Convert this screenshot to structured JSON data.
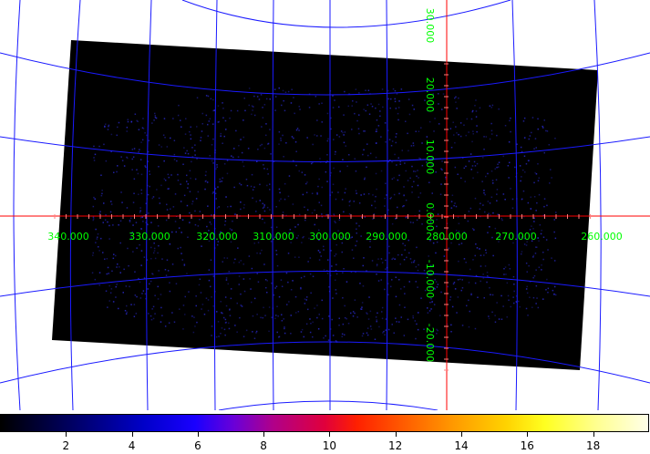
{
  "sky_axes": {
    "lon_labels": [
      {
        "text": "340.000",
        "value": 340
      },
      {
        "text": "330.000",
        "value": 330
      },
      {
        "text": "320.000",
        "value": 320
      },
      {
        "text": "310.000",
        "value": 310
      },
      {
        "text": "300.000",
        "value": 300
      },
      {
        "text": "290.000",
        "value": 290
      },
      {
        "text": "280.000",
        "value": 280
      },
      {
        "text": "270.000",
        "value": 270
      },
      {
        "text": "260.000",
        "value": 260
      }
    ],
    "lat_labels": [
      {
        "text": "30.000",
        "value": 30
      },
      {
        "text": "20.000",
        "value": 20
      },
      {
        "text": "10.000",
        "value": 10
      },
      {
        "text": "0.000",
        "value": 0
      },
      {
        "text": "-10.000",
        "value": -10
      },
      {
        "text": "-20.000",
        "value": -20
      }
    ]
  },
  "colors": {
    "grid": "#1a1aff",
    "crosshair": "#ff0000",
    "labels": "#00ff00",
    "image_bg": "#000000",
    "points": "#2a2acc"
  },
  "colorbar": {
    "ticks": [
      {
        "text": "2",
        "value": 2
      },
      {
        "text": "4",
        "value": 4
      },
      {
        "text": "6",
        "value": 6
      },
      {
        "text": "8",
        "value": 8
      },
      {
        "text": "10",
        "value": 10
      },
      {
        "text": "12",
        "value": 12
      },
      {
        "text": "14",
        "value": 14
      },
      {
        "text": "16",
        "value": 16
      },
      {
        "text": "18",
        "value": 18
      }
    ],
    "range": [
      0,
      19.7
    ],
    "colormap": "heat-blue"
  }
}
